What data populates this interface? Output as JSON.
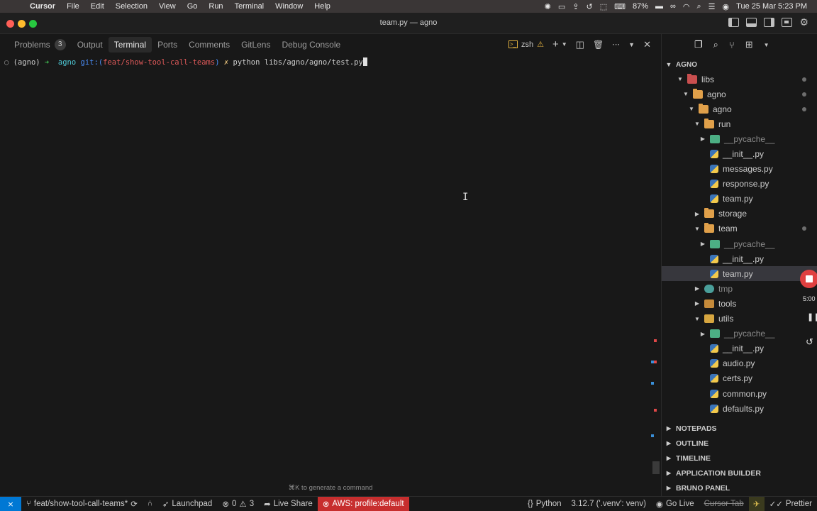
{
  "menubar": {
    "app": "Cursor",
    "items": [
      "File",
      "Edit",
      "Selection",
      "View",
      "Go",
      "Run",
      "Terminal",
      "Window",
      "Help"
    ],
    "battery": "87%",
    "datetime": "Tue 25 Mar  5:23 PM"
  },
  "window": {
    "title": "team.py — agno"
  },
  "panel": {
    "tabs": [
      {
        "label": "Problems",
        "badge": "3"
      },
      {
        "label": "Output"
      },
      {
        "label": "Terminal"
      },
      {
        "label": "Ports"
      },
      {
        "label": "Comments"
      },
      {
        "label": "GitLens"
      },
      {
        "label": "Debug Console"
      }
    ],
    "shell": "zsh",
    "hint": "⌘K to generate a command"
  },
  "terminal": {
    "env": "(agno)",
    "dir": "agno",
    "git_prefix": "git:(",
    "branch": "feat/show-tool-call-teams",
    "git_suffix": ")",
    "dirty": "✗",
    "command": "python libs/agno/agno/test.py"
  },
  "explorer": {
    "root": "AGNO",
    "nodes": [
      {
        "label": "libs",
        "depth": 0,
        "kind": "folder-lib",
        "open": true,
        "dot": true
      },
      {
        "label": "agno",
        "depth": 1,
        "kind": "folder",
        "open": true,
        "dot": true
      },
      {
        "label": "agno",
        "depth": 2,
        "kind": "folder",
        "open": true,
        "dot": true
      },
      {
        "label": "run",
        "depth": 3,
        "kind": "folder",
        "open": true
      },
      {
        "label": "__pycache__",
        "depth": 4,
        "kind": "folder-green",
        "open": false,
        "muted": true
      },
      {
        "label": "__init__.py",
        "depth": 4,
        "kind": "py"
      },
      {
        "label": "messages.py",
        "depth": 4,
        "kind": "py"
      },
      {
        "label": "response.py",
        "depth": 4,
        "kind": "py"
      },
      {
        "label": "team.py",
        "depth": 4,
        "kind": "py"
      },
      {
        "label": "storage",
        "depth": 3,
        "kind": "folder",
        "open": false
      },
      {
        "label": "team",
        "depth": 3,
        "kind": "folder",
        "open": true,
        "dot": true
      },
      {
        "label": "__pycache__",
        "depth": 4,
        "kind": "folder-green",
        "open": false,
        "muted": true
      },
      {
        "label": "__init__.py",
        "depth": 4,
        "kind": "py"
      },
      {
        "label": "team.py",
        "depth": 4,
        "kind": "py",
        "selected": true
      },
      {
        "label": "tmp",
        "depth": 3,
        "kind": "folder-teal",
        "open": false,
        "muted": true
      },
      {
        "label": "tools",
        "depth": 3,
        "kind": "folder-tools",
        "open": false
      },
      {
        "label": "utils",
        "depth": 3,
        "kind": "folder-utils",
        "open": true
      },
      {
        "label": "__pycache__",
        "depth": 4,
        "kind": "folder-green",
        "open": false,
        "muted": true
      },
      {
        "label": "__init__.py",
        "depth": 4,
        "kind": "py"
      },
      {
        "label": "audio.py",
        "depth": 4,
        "kind": "py"
      },
      {
        "label": "certs.py",
        "depth": 4,
        "kind": "py"
      },
      {
        "label": "common.py",
        "depth": 4,
        "kind": "py"
      },
      {
        "label": "defaults.py",
        "depth": 4,
        "kind": "py"
      }
    ],
    "sections": [
      "NOTEPADS",
      "OUTLINE",
      "TIMELINE",
      "APPLICATION BUILDER",
      "BRUNO PANEL"
    ]
  },
  "recording": {
    "time": "5:00"
  },
  "statusbar": {
    "branch": "feat/show-tool-call-teams*",
    "launchpad": "Launchpad",
    "errors": "0",
    "warnings": "3",
    "live_share": "Live Share",
    "aws": "AWS: profile:default",
    "language": "Python",
    "interpreter": "3.12.7 ('.venv': venv)",
    "go_live": "Go Live",
    "cursor_tab": "Cursor Tab",
    "prettier": "Prettier"
  },
  "colors": {
    "accent": "#0078d4",
    "aws": "#c72e2e",
    "branch": "#e15a5a",
    "folder": "#e0a04a"
  }
}
